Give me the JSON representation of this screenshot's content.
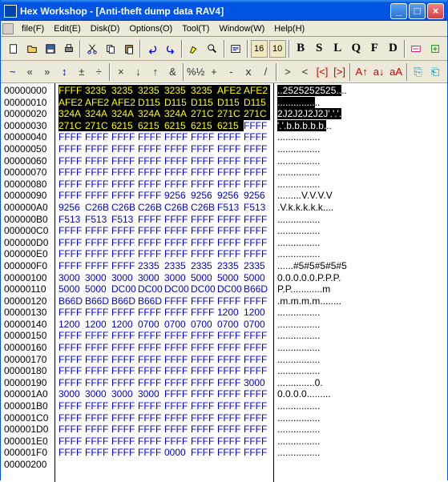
{
  "title": "Hex Workshop - [Anti-theft dump data RAV4]",
  "menu": {
    "file": "file(F)",
    "edit": "Edit(E)",
    "disk": "Disk(D)",
    "options": "Options(O)",
    "tool": "Tool(T)",
    "window": "Window(W)",
    "help": "Help(H)"
  },
  "tb1": {
    "b16": "16",
    "b10": "10",
    "B": "B",
    "S": "S",
    "L": "L",
    "Q": "Q",
    "F": "F",
    "D": "D"
  },
  "tb2": {
    "a": "~",
    "b": "«",
    "c": "»",
    "d": "↕",
    "e": "±",
    "f": "÷",
    "g": "×",
    "h": "↓",
    "i": "↑",
    "j": "&",
    "k": "%½",
    "l": "+",
    "m": "-",
    "n": "ⅹ",
    "o": "/",
    "p": ">",
    "q": "<",
    "r": "[<]",
    "s": "[>]",
    "t": "A↑",
    "u": "a↓",
    "v": "aA",
    "w1": "⎘",
    "w2": "⎗"
  },
  "offsets": [
    "00000000",
    "00000010",
    "00000020",
    "00000030",
    "00000040",
    "00000050",
    "00000060",
    "00000070",
    "00000080",
    "00000090",
    "000000A0",
    "000000B0",
    "000000C0",
    "000000D0",
    "000000E0",
    "000000F0",
    "00000100",
    "00000110",
    "00000120",
    "00000130",
    "00000140",
    "00000150",
    "00000160",
    "00000170",
    "00000180",
    "00000190",
    "000001A0",
    "000001B0",
    "000001C0",
    "000001D0",
    "000001E0",
    "000001F0",
    "00000200"
  ],
  "hex": [
    [
      [
        "FFFF",
        "hl"
      ],
      [
        "3235",
        "hl"
      ],
      [
        "3235",
        "hl"
      ],
      [
        "3235",
        "hl"
      ],
      [
        "3235",
        "hl"
      ],
      [
        "3235",
        "hl"
      ],
      [
        "AFE2",
        "hl"
      ],
      [
        "AFE2",
        "hl"
      ]
    ],
    [
      [
        "AFE2",
        "hl"
      ],
      [
        "AFE2",
        "hl"
      ],
      [
        "AFE2",
        "hl"
      ],
      [
        "D115",
        "hl"
      ],
      [
        "D115",
        "hl"
      ],
      [
        "D115",
        "hl"
      ],
      [
        "D115",
        "hl"
      ],
      [
        "D115",
        "hl"
      ]
    ],
    [
      [
        "324A",
        "hl"
      ],
      [
        "324A",
        "hl"
      ],
      [
        "324A",
        "hl"
      ],
      [
        "324A",
        "hl"
      ],
      [
        "324A",
        "hl"
      ],
      [
        "271C",
        "hl"
      ],
      [
        "271C",
        "hl"
      ],
      [
        "271C",
        "hl"
      ]
    ],
    [
      [
        "271C",
        "hl"
      ],
      [
        "271C",
        "hl"
      ],
      [
        "6215",
        "hl"
      ],
      [
        "6215",
        "hl"
      ],
      [
        "6215",
        "hl"
      ],
      [
        "6215",
        "hl"
      ],
      [
        "6215",
        "hl"
      ],
      [
        "FFFF",
        ""
      ]
    ],
    [
      [
        "FFFF",
        ""
      ],
      [
        "FFFF",
        ""
      ],
      [
        "FFFF",
        ""
      ],
      [
        "FFFF",
        ""
      ],
      [
        "FFFF",
        ""
      ],
      [
        "FFFF",
        ""
      ],
      [
        "FFFF",
        ""
      ],
      [
        "FFFF",
        ""
      ]
    ],
    [
      [
        "FFFF",
        ""
      ],
      [
        "FFFF",
        ""
      ],
      [
        "FFFF",
        ""
      ],
      [
        "FFFF",
        ""
      ],
      [
        "FFFF",
        ""
      ],
      [
        "FFFF",
        ""
      ],
      [
        "FFFF",
        ""
      ],
      [
        "FFFF",
        ""
      ]
    ],
    [
      [
        "FFFF",
        ""
      ],
      [
        "FFFF",
        ""
      ],
      [
        "FFFF",
        ""
      ],
      [
        "FFFF",
        ""
      ],
      [
        "FFFF",
        ""
      ],
      [
        "FFFF",
        ""
      ],
      [
        "FFFF",
        ""
      ],
      [
        "FFFF",
        ""
      ]
    ],
    [
      [
        "FFFF",
        ""
      ],
      [
        "FFFF",
        ""
      ],
      [
        "FFFF",
        ""
      ],
      [
        "FFFF",
        ""
      ],
      [
        "FFFF",
        ""
      ],
      [
        "FFFF",
        ""
      ],
      [
        "FFFF",
        ""
      ],
      [
        "FFFF",
        ""
      ]
    ],
    [
      [
        "FFFF",
        ""
      ],
      [
        "FFFF",
        ""
      ],
      [
        "FFFF",
        ""
      ],
      [
        "FFFF",
        ""
      ],
      [
        "FFFF",
        ""
      ],
      [
        "FFFF",
        ""
      ],
      [
        "FFFF",
        ""
      ],
      [
        "FFFF",
        ""
      ]
    ],
    [
      [
        "FFFF",
        ""
      ],
      [
        "FFFF",
        ""
      ],
      [
        "FFFF",
        ""
      ],
      [
        "FFFF",
        ""
      ],
      [
        "9256",
        ""
      ],
      [
        "9256",
        ""
      ],
      [
        "9256",
        ""
      ],
      [
        "9256",
        ""
      ]
    ],
    [
      [
        "9256",
        ""
      ],
      [
        "C26B",
        ""
      ],
      [
        "C26B",
        ""
      ],
      [
        "C26B",
        ""
      ],
      [
        "C26B",
        ""
      ],
      [
        "C26B",
        ""
      ],
      [
        "F513",
        ""
      ],
      [
        "F513",
        ""
      ]
    ],
    [
      [
        "F513",
        ""
      ],
      [
        "F513",
        ""
      ],
      [
        "F513",
        ""
      ],
      [
        "FFFF",
        ""
      ],
      [
        "FFFF",
        ""
      ],
      [
        "FFFF",
        ""
      ],
      [
        "FFFF",
        ""
      ],
      [
        "FFFF",
        ""
      ]
    ],
    [
      [
        "FFFF",
        ""
      ],
      [
        "FFFF",
        ""
      ],
      [
        "FFFF",
        ""
      ],
      [
        "FFFF",
        ""
      ],
      [
        "FFFF",
        ""
      ],
      [
        "FFFF",
        ""
      ],
      [
        "FFFF",
        ""
      ],
      [
        "FFFF",
        ""
      ]
    ],
    [
      [
        "FFFF",
        ""
      ],
      [
        "FFFF",
        ""
      ],
      [
        "FFFF",
        ""
      ],
      [
        "FFFF",
        ""
      ],
      [
        "FFFF",
        ""
      ],
      [
        "FFFF",
        ""
      ],
      [
        "FFFF",
        ""
      ],
      [
        "FFFF",
        ""
      ]
    ],
    [
      [
        "FFFF",
        ""
      ],
      [
        "FFFF",
        ""
      ],
      [
        "FFFF",
        ""
      ],
      [
        "FFFF",
        ""
      ],
      [
        "FFFF",
        ""
      ],
      [
        "FFFF",
        ""
      ],
      [
        "FFFF",
        ""
      ],
      [
        "FFFF",
        ""
      ]
    ],
    [
      [
        "FFFF",
        ""
      ],
      [
        "FFFF",
        ""
      ],
      [
        "FFFF",
        ""
      ],
      [
        "2335",
        ""
      ],
      [
        "2335",
        ""
      ],
      [
        "2335",
        ""
      ],
      [
        "2335",
        ""
      ],
      [
        "2335",
        ""
      ]
    ],
    [
      [
        "3000",
        ""
      ],
      [
        "3000",
        ""
      ],
      [
        "3000",
        ""
      ],
      [
        "3000",
        ""
      ],
      [
        "3000",
        ""
      ],
      [
        "5000",
        ""
      ],
      [
        "5000",
        ""
      ],
      [
        "5000",
        ""
      ]
    ],
    [
      [
        "5000",
        ""
      ],
      [
        "5000",
        ""
      ],
      [
        "DC00",
        ""
      ],
      [
        "DC00",
        ""
      ],
      [
        "DC00",
        ""
      ],
      [
        "DC00",
        ""
      ],
      [
        "DC00",
        ""
      ],
      [
        "B66D",
        ""
      ]
    ],
    [
      [
        "B66D",
        ""
      ],
      [
        "B66D",
        ""
      ],
      [
        "B66D",
        ""
      ],
      [
        "B66D",
        ""
      ],
      [
        "FFFF",
        ""
      ],
      [
        "FFFF",
        ""
      ],
      [
        "FFFF",
        ""
      ],
      [
        "FFFF",
        ""
      ]
    ],
    [
      [
        "FFFF",
        ""
      ],
      [
        "FFFF",
        ""
      ],
      [
        "FFFF",
        ""
      ],
      [
        "FFFF",
        ""
      ],
      [
        "FFFF",
        ""
      ],
      [
        "FFFF",
        ""
      ],
      [
        "1200",
        ""
      ],
      [
        "1200",
        ""
      ]
    ],
    [
      [
        "1200",
        ""
      ],
      [
        "1200",
        ""
      ],
      [
        "1200",
        ""
      ],
      [
        "0700",
        ""
      ],
      [
        "0700",
        ""
      ],
      [
        "0700",
        ""
      ],
      [
        "0700",
        ""
      ],
      [
        "0700",
        ""
      ]
    ],
    [
      [
        "FFFF",
        ""
      ],
      [
        "FFFF",
        ""
      ],
      [
        "FFFF",
        ""
      ],
      [
        "FFFF",
        ""
      ],
      [
        "FFFF",
        ""
      ],
      [
        "FFFF",
        ""
      ],
      [
        "FFFF",
        ""
      ],
      [
        "FFFF",
        ""
      ]
    ],
    [
      [
        "FFFF",
        ""
      ],
      [
        "FFFF",
        ""
      ],
      [
        "FFFF",
        ""
      ],
      [
        "FFFF",
        ""
      ],
      [
        "FFFF",
        ""
      ],
      [
        "FFFF",
        ""
      ],
      [
        "FFFF",
        ""
      ],
      [
        "FFFF",
        ""
      ]
    ],
    [
      [
        "FFFF",
        ""
      ],
      [
        "FFFF",
        ""
      ],
      [
        "FFFF",
        ""
      ],
      [
        "FFFF",
        ""
      ],
      [
        "FFFF",
        ""
      ],
      [
        "FFFF",
        ""
      ],
      [
        "FFFF",
        ""
      ],
      [
        "FFFF",
        ""
      ]
    ],
    [
      [
        "FFFF",
        ""
      ],
      [
        "FFFF",
        ""
      ],
      [
        "FFFF",
        ""
      ],
      [
        "FFFF",
        ""
      ],
      [
        "FFFF",
        ""
      ],
      [
        "FFFF",
        ""
      ],
      [
        "FFFF",
        ""
      ],
      [
        "FFFF",
        ""
      ]
    ],
    [
      [
        "FFFF",
        ""
      ],
      [
        "FFFF",
        ""
      ],
      [
        "FFFF",
        ""
      ],
      [
        "FFFF",
        ""
      ],
      [
        "FFFF",
        ""
      ],
      [
        "FFFF",
        ""
      ],
      [
        "FFFF",
        ""
      ],
      [
        "3000",
        ""
      ]
    ],
    [
      [
        "3000",
        ""
      ],
      [
        "3000",
        ""
      ],
      [
        "3000",
        ""
      ],
      [
        "3000",
        ""
      ],
      [
        "FFFF",
        ""
      ],
      [
        "FFFF",
        ""
      ],
      [
        "FFFF",
        ""
      ],
      [
        "FFFF",
        ""
      ]
    ],
    [
      [
        "FFFF",
        ""
      ],
      [
        "FFFF",
        ""
      ],
      [
        "FFFF",
        ""
      ],
      [
        "FFFF",
        ""
      ],
      [
        "FFFF",
        ""
      ],
      [
        "FFFF",
        ""
      ],
      [
        "FFFF",
        ""
      ],
      [
        "FFFF",
        ""
      ]
    ],
    [
      [
        "FFFF",
        ""
      ],
      [
        "FFFF",
        ""
      ],
      [
        "FFFF",
        ""
      ],
      [
        "FFFF",
        ""
      ],
      [
        "FFFF",
        ""
      ],
      [
        "FFFF",
        ""
      ],
      [
        "FFFF",
        ""
      ],
      [
        "FFFF",
        ""
      ]
    ],
    [
      [
        "FFFF",
        ""
      ],
      [
        "FFFF",
        ""
      ],
      [
        "FFFF",
        ""
      ],
      [
        "FFFF",
        ""
      ],
      [
        "FFFF",
        ""
      ],
      [
        "FFFF",
        ""
      ],
      [
        "FFFF",
        ""
      ],
      [
        "FFFF",
        ""
      ]
    ],
    [
      [
        "FFFF",
        ""
      ],
      [
        "FFFF",
        ""
      ],
      [
        "FFFF",
        ""
      ],
      [
        "FFFF",
        ""
      ],
      [
        "FFFF",
        ""
      ],
      [
        "FFFF",
        ""
      ],
      [
        "FFFF",
        ""
      ],
      [
        "FFFF",
        ""
      ]
    ],
    [
      [
        "FFFF",
        ""
      ],
      [
        "FFFF",
        ""
      ],
      [
        "FFFF",
        ""
      ],
      [
        "FFFF",
        ""
      ],
      [
        "0000",
        ""
      ],
      [
        "FFFF",
        ""
      ],
      [
        "FFFF",
        ""
      ],
      [
        "FFFF",
        ""
      ]
    ]
  ],
  "ascii": [
    [
      [
        "..2525252525..",
        "bk"
      ],
      [
        "..",
        ""
      ]
    ],
    [
      [
        "..............",
        "bk"
      ],
      [
        "..",
        ""
      ]
    ],
    [
      [
        "2J2J2J2J2J'.'.'.",
        "bk"
      ]
    ],
    [
      [
        "'.'.b.b.b.b.b.",
        "bk"
      ],
      [
        "..",
        ""
      ]
    ],
    [
      [
        "................",
        ""
      ]
    ],
    [
      [
        "................",
        ""
      ]
    ],
    [
      [
        "................",
        ""
      ]
    ],
    [
      [
        "................",
        ""
      ]
    ],
    [
      [
        "................",
        ""
      ]
    ],
    [
      [
        ".........V.V.V.V",
        ""
      ]
    ],
    [
      [
        ".V.k.k.k.k.k....",
        ""
      ]
    ],
    [
      [
        "................",
        ""
      ]
    ],
    [
      [
        "................",
        ""
      ]
    ],
    [
      [
        "................",
        ""
      ]
    ],
    [
      [
        "................",
        ""
      ]
    ],
    [
      [
        "......#5#5#5#5#5",
        ""
      ]
    ],
    [
      [
        "0.0.0.0.0.P.P.P.",
        ""
      ]
    ],
    [
      [
        "P.P............m",
        ""
      ]
    ],
    [
      [
        ".m.m.m.m........",
        ""
      ]
    ],
    [
      [
        "................",
        ""
      ]
    ],
    [
      [
        "................",
        ""
      ]
    ],
    [
      [
        "................",
        ""
      ]
    ],
    [
      [
        "................",
        ""
      ]
    ],
    [
      [
        "................",
        ""
      ]
    ],
    [
      [
        "................",
        ""
      ]
    ],
    [
      [
        "..............0.",
        ""
      ]
    ],
    [
      [
        "0.0.0.0.........",
        ""
      ]
    ],
    [
      [
        "................",
        ""
      ]
    ],
    [
      [
        "................",
        ""
      ]
    ],
    [
      [
        "................",
        ""
      ]
    ],
    [
      [
        "................",
        ""
      ]
    ],
    [
      [
        "................",
        ""
      ]
    ]
  ]
}
